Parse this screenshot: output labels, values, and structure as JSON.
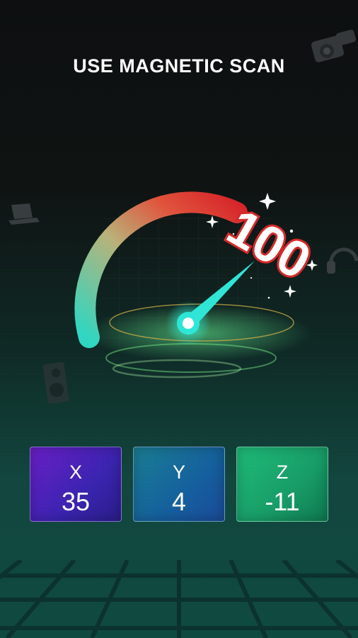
{
  "header": {
    "title": "USE MAGNETIC SCAN"
  },
  "gauge": {
    "value": "100",
    "level": 1.0,
    "colors": {
      "low": "#2fd6c1",
      "mid": "#c9a06a",
      "high": "#e23a3a",
      "needle": "#2fe6d6"
    }
  },
  "readings": [
    {
      "axis": "X",
      "value": "35"
    },
    {
      "axis": "Y",
      "value": "4"
    },
    {
      "axis": "Z",
      "value": "-11"
    }
  ],
  "icons": [
    "camera-icon",
    "laptop-icon",
    "headphones-icon",
    "speaker-icon"
  ]
}
